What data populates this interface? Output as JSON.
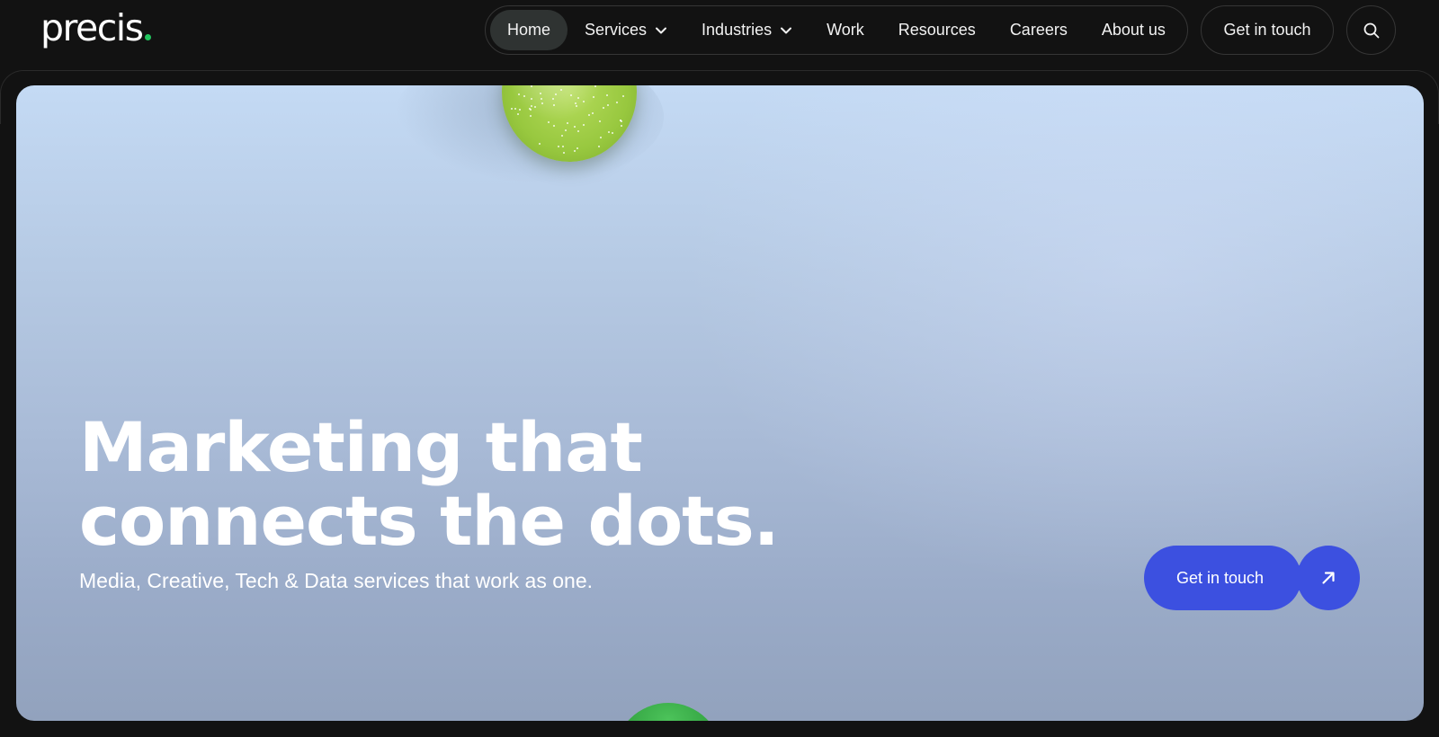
{
  "brand": {
    "name": "precis",
    "dot_color": "#22c55e"
  },
  "nav": {
    "items": [
      {
        "label": "Home",
        "active": true,
        "has_dropdown": false
      },
      {
        "label": "Services",
        "active": false,
        "has_dropdown": true
      },
      {
        "label": "Industries",
        "active": false,
        "has_dropdown": true
      },
      {
        "label": "Work",
        "active": false,
        "has_dropdown": false
      },
      {
        "label": "Resources",
        "active": false,
        "has_dropdown": false
      },
      {
        "label": "Careers",
        "active": false,
        "has_dropdown": false
      },
      {
        "label": "About us",
        "active": false,
        "has_dropdown": false
      }
    ],
    "contact_label": "Get in touch",
    "search_icon": "search-icon"
  },
  "hero": {
    "headline_line1": "Marketing that",
    "headline_line2": "connects the dots.",
    "subline": "Media, Creative, Tech & Data services that work as one.",
    "cta_label": "Get in touch",
    "cta_icon": "arrow-up-right-icon",
    "cta_color": "#3c50e0"
  },
  "colors": {
    "background": "#121212",
    "nav_active_bg": "#2f3332",
    "ball_top": "#98c83f",
    "ball_bottom": "#2f9e3e"
  }
}
